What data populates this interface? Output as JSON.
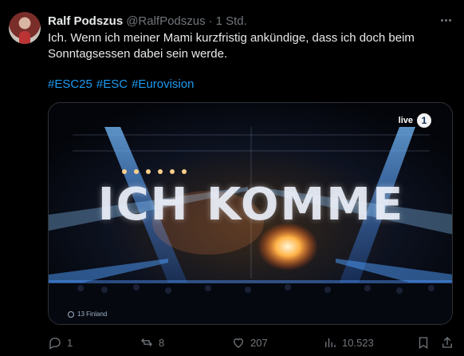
{
  "tweet": {
    "author_name": "Ralf Podszus",
    "handle": "@RalfPodszus",
    "separator": "·",
    "time": "1 Std.",
    "text": "Ich. Wenn ich meiner Mami kurzfristig ankündige, dass ich doch beim Sonntagsessen dabei sein werde.",
    "hashtags": [
      "#ESC25",
      "#ESC",
      "#Eurovision"
    ]
  },
  "media": {
    "overlay_text": "ICH KOMME",
    "live_label": "live",
    "channel_logo": "1",
    "caption": "13 Finland"
  },
  "actions": {
    "replies": "1",
    "reposts": "8",
    "likes": "207",
    "views": "10.523"
  },
  "icons": {
    "reply": "reply-icon",
    "repost": "repost-icon",
    "like": "like-icon",
    "views": "views-icon",
    "bookmark": "bookmark-icon",
    "share": "share-icon",
    "more": "more-icon"
  },
  "colors": {
    "background": "#000000",
    "text": "#e7e9ea",
    "muted": "#71767b",
    "link": "#1d9bf0"
  }
}
